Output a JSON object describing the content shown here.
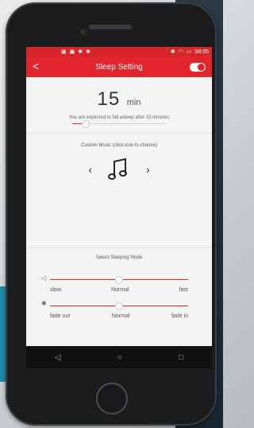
{
  "status": {
    "time": "08:05",
    "signal_icons": [
      "image-icon",
      "image-icon",
      "star-icon",
      "star-icon"
    ],
    "status_icons": [
      "bluetooth-icon",
      "wifi-icon",
      "battery-icon"
    ]
  },
  "appbar": {
    "title": "Sleep Setting",
    "back": "<"
  },
  "time": {
    "value": "15",
    "unit": "min",
    "description": "You are expected to fall asleep after 15 minutes"
  },
  "music": {
    "label": "Custom Music (click icon to choose)",
    "left_arrow": "‹",
    "right_arrow": "›",
    "note_icon": "music-note-icon"
  },
  "mode": {
    "label": "Select Sleeping Mode",
    "speed_tags": [
      "slow",
      "Normal",
      "fast"
    ],
    "fade_tags": [
      "fade out",
      "Normal",
      "fade in"
    ]
  },
  "nav": {
    "back": "◁",
    "home": "○",
    "recents": "□"
  },
  "colors": {
    "accent": "#e2252c",
    "background": "#f4f4f4"
  }
}
